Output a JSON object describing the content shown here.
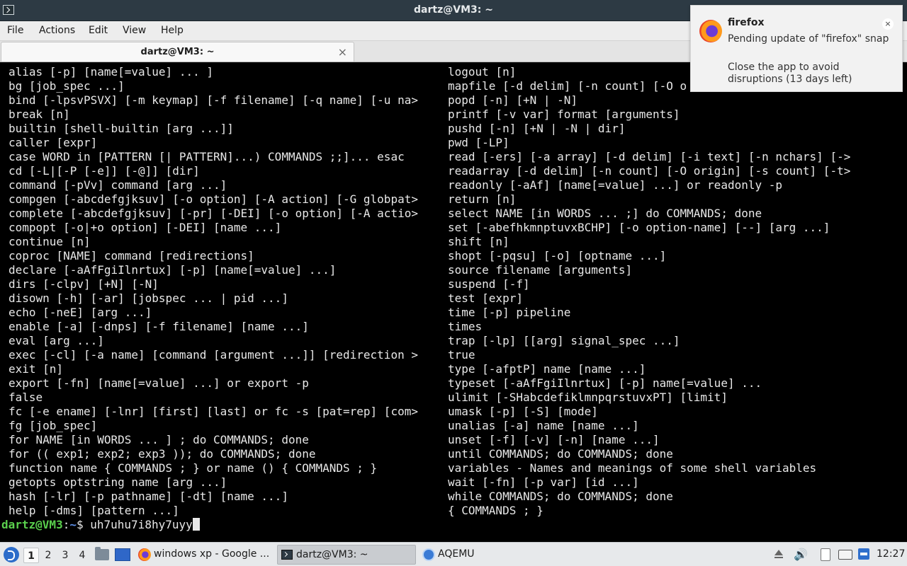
{
  "window": {
    "title": "dartz@VM3: ~"
  },
  "menu": [
    "File",
    "Actions",
    "Edit",
    "View",
    "Help"
  ],
  "tab": {
    "label": "dartz@VM3: ~",
    "close": "×"
  },
  "terminal": {
    "left_lines": [
      "alias [-p] [name[=value] ... ]",
      "bg [job_spec ...]",
      "bind [-lpsvPSVX] [-m keymap] [-f filename] [-q name] [-u na>",
      "break [n]",
      "builtin [shell-builtin [arg ...]]",
      "caller [expr]",
      "case WORD in [PATTERN [| PATTERN]...) COMMANDS ;;]... esac",
      "cd [-L|[-P [-e]] [-@]] [dir]",
      "command [-pVv] command [arg ...]",
      "compgen [-abcdefgjksuv] [-o option] [-A action] [-G globpat>",
      "complete [-abcdefgjksuv] [-pr] [-DEI] [-o option] [-A actio>",
      "compopt [-o|+o option] [-DEI] [name ...]",
      "continue [n]",
      "coproc [NAME] command [redirections]",
      "declare [-aAfFgiIlnrtux] [-p] [name[=value] ...]",
      "dirs [-clpv] [+N] [-N]",
      "disown [-h] [-ar] [jobspec ... | pid ...]",
      "echo [-neE] [arg ...]",
      "enable [-a] [-dnps] [-f filename] [name ...]",
      "eval [arg ...]",
      "exec [-cl] [-a name] [command [argument ...]] [redirection >",
      "exit [n]",
      "export [-fn] [name[=value] ...] or export -p",
      "false",
      "fc [-e ename] [-lnr] [first] [last] or fc -s [pat=rep] [com>",
      "fg [job_spec]",
      "for NAME [in WORDS ... ] ; do COMMANDS; done",
      "for (( exp1; exp2; exp3 )); do COMMANDS; done",
      "function name { COMMANDS ; } or name () { COMMANDS ; }",
      "getopts optstring name [arg ...]",
      "hash [-lr] [-p pathname] [-dt] [name ...]",
      "help [-dms] [pattern ...]"
    ],
    "right_lines": [
      "logout [n]",
      "mapfile [-d delim] [-n count] [-O o",
      "popd [-n] [+N | -N]",
      "printf [-v var] format [arguments]",
      "pushd [-n] [+N | -N | dir]",
      "pwd [-LP]",
      "read [-ers] [-a array] [-d delim] [-i text] [-n nchars] [->",
      "readarray [-d delim] [-n count] [-O origin] [-s count] [-t>",
      "readonly [-aAf] [name[=value] ...] or readonly -p",
      "return [n]",
      "select NAME [in WORDS ... ;] do COMMANDS; done",
      "set [-abefhkmnptuvxBCHP] [-o option-name] [--] [arg ...]",
      "shift [n]",
      "shopt [-pqsu] [-o] [optname ...]",
      "source filename [arguments]",
      "suspend [-f]",
      "test [expr]",
      "time [-p] pipeline",
      "times",
      "trap [-lp] [[arg] signal_spec ...]",
      "true",
      "type [-afptP] name [name ...]",
      "typeset [-aAfFgiIlnrtux] [-p] name[=value] ...",
      "ulimit [-SHabcdefiklmnpqrstuvxPT] [limit]",
      "umask [-p] [-S] [mode]",
      "unalias [-a] name [name ...]",
      "unset [-f] [-v] [-n] [name ...]",
      "until COMMANDS; do COMMANDS; done",
      "variables - Names and meanings of some shell variables",
      "wait [-fn] [-p var] [id ...]",
      "while COMMANDS; do COMMANDS; done",
      "{ COMMANDS ; }"
    ],
    "prompt": {
      "user": "dartz@VM3",
      "sep": ":",
      "path": "~",
      "symbol": "$ ",
      "input": "uh7uhu7i8hy7uyy"
    }
  },
  "notification": {
    "app": "firefox",
    "body1": "Pending update of \"firefox\" snap",
    "body2": "Close the app to avoid disruptions (13 days left)",
    "close": "×"
  },
  "taskbar": {
    "workspaces": [
      "1",
      "2",
      "3",
      "4"
    ],
    "tasks": [
      {
        "label": "windows xp - Google ..."
      },
      {
        "label": "dartz@VM3: ~"
      },
      {
        "label": "AQEMU"
      }
    ],
    "clock": "12:27"
  },
  "colors": {
    "prompt_user": "#5ad04d",
    "prompt_path": "#5d8fe6",
    "terminal_bg": "#000000",
    "terminal_fg": "#e8e8e8"
  }
}
